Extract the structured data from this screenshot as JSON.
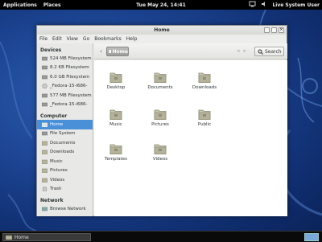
{
  "top_panel": {
    "applications": "Applications",
    "places": "Places",
    "clock": "Tue May 24, 14:41",
    "user": "Live System User"
  },
  "window": {
    "title": "Home",
    "menu": [
      "File",
      "Edit",
      "View",
      "Go",
      "Bookmarks",
      "Help"
    ]
  },
  "toolbar": {
    "path": "Home",
    "search": "Search"
  },
  "sidebar": {
    "devices_header": "Devices",
    "devices": [
      "524 MB Filesystem",
      "8.2 KB Filesystem",
      "6.0 GB Filesystem",
      "_Fedora-15-i686-",
      "577 MB Filesystem",
      "_Fedora-15-i686-"
    ],
    "computer_header": "Computer",
    "computer": [
      "Home",
      "File System",
      "Documents",
      "Downloads",
      "Music",
      "Pictures",
      "Videos",
      "Trash"
    ],
    "network_header": "Network",
    "network": [
      "Browse Network"
    ]
  },
  "files": [
    "Desktop",
    "Documents",
    "Downloads",
    "Music",
    "Pictures",
    "Public",
    "Templates",
    "Videos"
  ],
  "taskbar": {
    "task": "Home"
  },
  "colors": {
    "selection": "#4a90d9",
    "desktop": "#1b428f",
    "panel": "#000000"
  }
}
